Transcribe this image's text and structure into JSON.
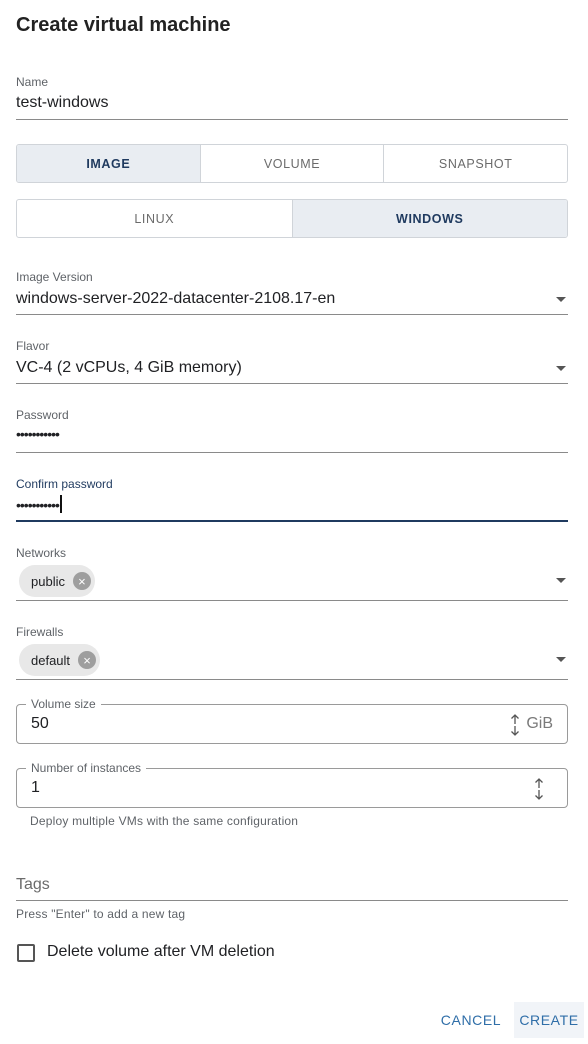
{
  "dialog": {
    "title": "Create virtual machine"
  },
  "name": {
    "label": "Name",
    "value": "test-windows"
  },
  "source_tabs": [
    {
      "label": "IMAGE",
      "active": true
    },
    {
      "label": "VOLUME",
      "active": false
    },
    {
      "label": "SNAPSHOT",
      "active": false
    }
  ],
  "os_tabs": [
    {
      "label": "LINUX",
      "active": false
    },
    {
      "label": "WINDOWS",
      "active": true
    }
  ],
  "image_version": {
    "label": "Image Version",
    "value": "windows-server-2022-datacenter-2108.17-en"
  },
  "flavor": {
    "label": "Flavor",
    "value": "VC-4 (2 vCPUs, 4 GiB memory)"
  },
  "password": {
    "label": "Password",
    "value": "•••••••••••"
  },
  "confirm_password": {
    "label": "Confirm password",
    "value": "•••••••••••"
  },
  "networks": {
    "label": "Networks",
    "chips": [
      "public"
    ]
  },
  "firewalls": {
    "label": "Firewalls",
    "chips": [
      "default"
    ]
  },
  "volume_size": {
    "label": "Volume size",
    "value": "50",
    "unit": "GiB"
  },
  "instances": {
    "label": "Number of instances",
    "value": "1",
    "helper": "Deploy multiple VMs with the same configuration"
  },
  "tags": {
    "placeholder": "Tags",
    "helper": "Press \"Enter\" to add a new tag"
  },
  "delete_volume": {
    "label": "Delete volume after VM deletion",
    "checked": false
  },
  "actions": {
    "cancel": "CANCEL",
    "create": "CREATE"
  },
  "colors": {
    "accent": "#1f3a5f",
    "button_text": "#2f6ea8",
    "active_tab_bg": "#e9edf2"
  }
}
